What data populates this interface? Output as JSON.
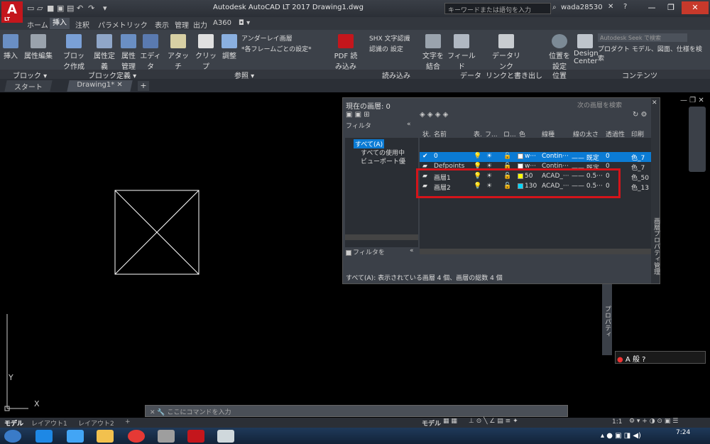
{
  "app": {
    "logo_text": "A",
    "logo_sub": "LT",
    "window_title": "Autodesk AutoCAD LT 2017    Drawing1.dwg",
    "search_placeholder": "キーワードまたは語句を入力",
    "user": "wada28530"
  },
  "ribbon_tabs": [
    "ホーム",
    "挿入",
    "注釈",
    "パラメトリック",
    "表示",
    "管理",
    "出力",
    "A360"
  ],
  "active_tab": "挿入",
  "ribbon_buttons": [
    {
      "label": "挿入",
      "icon": "insert-block-icon"
    },
    {
      "label": "属性編集",
      "icon": "edit-attribute-icon"
    },
    {
      "label": "ブロック作成",
      "icon": "create-block-icon"
    },
    {
      "label": "属性定義",
      "icon": "define-attribute-icon"
    },
    {
      "label": "属性管理",
      "icon": "manage-attributes-icon"
    },
    {
      "label": "エディタ",
      "icon": "block-editor-icon"
    },
    {
      "label": "アタッチ",
      "icon": "attach-icon"
    },
    {
      "label": "クリップ",
      "icon": "clip-icon"
    },
    {
      "label": "調整",
      "icon": "adjust-icon"
    },
    {
      "label": "PDF 読み込み",
      "icon": "pdf-import-icon"
    },
    {
      "label": "文字を結合",
      "icon": "combine-text-icon"
    },
    {
      "label": "フィールド",
      "icon": "field-icon"
    },
    {
      "label": "データリンク",
      "icon": "data-link-icon"
    },
    {
      "label": "位置を設定",
      "icon": "set-location-icon"
    },
    {
      "label": "Design Center",
      "icon": "design-center-icon"
    }
  ],
  "ribbon_small": {
    "underlay_layers": "アンダーレイ画層",
    "frames": "*各フレームごとの設定*",
    "shx_text": "SHX 文字認識",
    "recog_settings": "認識の 設定",
    "seek_placeholder": "Autodesk Seek で検索",
    "seek_desc": "プロダクト モデル、図面、仕様を検索"
  },
  "panel_labels": [
    "ブロック ▾",
    "ブロック定義 ▾",
    "参照 ▾",
    "読み込み",
    "データ",
    "リンクと書き出し",
    "位置",
    "コンテンツ"
  ],
  "doc_tabs": [
    "スタート",
    "Drawing1*"
  ],
  "layer_palette": {
    "current": "現在の画層: 0",
    "search_placeholder": "次の画層を検索",
    "filter_label": "フィルタ",
    "collapse": "«",
    "tree": [
      "すべて(A)",
      "すべての使用中",
      "ビューポート優"
    ],
    "invert_filter": "フィルタを",
    "columns": [
      "状.",
      "名前",
      "表.",
      "フ...",
      "ロ...",
      "色",
      "線種",
      "線の太さ",
      "透過性",
      "印刷"
    ],
    "rows": [
      {
        "name": "0",
        "color_name": "w···",
        "color": "#ffffff",
        "linetype": "Contin···",
        "lineweight": "—— 既定",
        "transparency": "0",
        "plot": "色_7"
      },
      {
        "name": "Defpoints",
        "color_name": "w···",
        "color": "#ffffff",
        "linetype": "Contin···",
        "lineweight": "—— 既定",
        "transparency": "0",
        "plot": "色_7"
      },
      {
        "name": "画層1",
        "color_name": "50",
        "color": "#ffff00",
        "linetype": "ACAD_···",
        "lineweight": "—— 0.5···",
        "transparency": "0",
        "plot": "色_50"
      },
      {
        "name": "画層2",
        "color_name": "130",
        "color": "#00d8ff",
        "linetype": "ACAD_···",
        "lineweight": "—— 0.5···",
        "transparency": "0",
        "plot": "色_13"
      }
    ],
    "status": "すべて(A): 表示されている画層 4 個、画層の総数 4 個",
    "side_title": "画層プロパティ管理",
    "props_title": "プロパティ"
  },
  "command_line": {
    "placeholder": "ここにコマンドを入力"
  },
  "layout_tabs": [
    "モデル",
    "レイアウト1",
    "レイアウト2",
    "+"
  ],
  "status_bar": {
    "model": "モデル",
    "scale": "1:1"
  },
  "ime": {
    "mode": "A 般"
  },
  "clock": {
    "time": "7:24"
  },
  "ucs": {
    "x": "X",
    "y": "Y"
  },
  "colors": {
    "highlight": "#d4141a",
    "selection": "#0b7bd4",
    "logo": "#c4161c"
  }
}
